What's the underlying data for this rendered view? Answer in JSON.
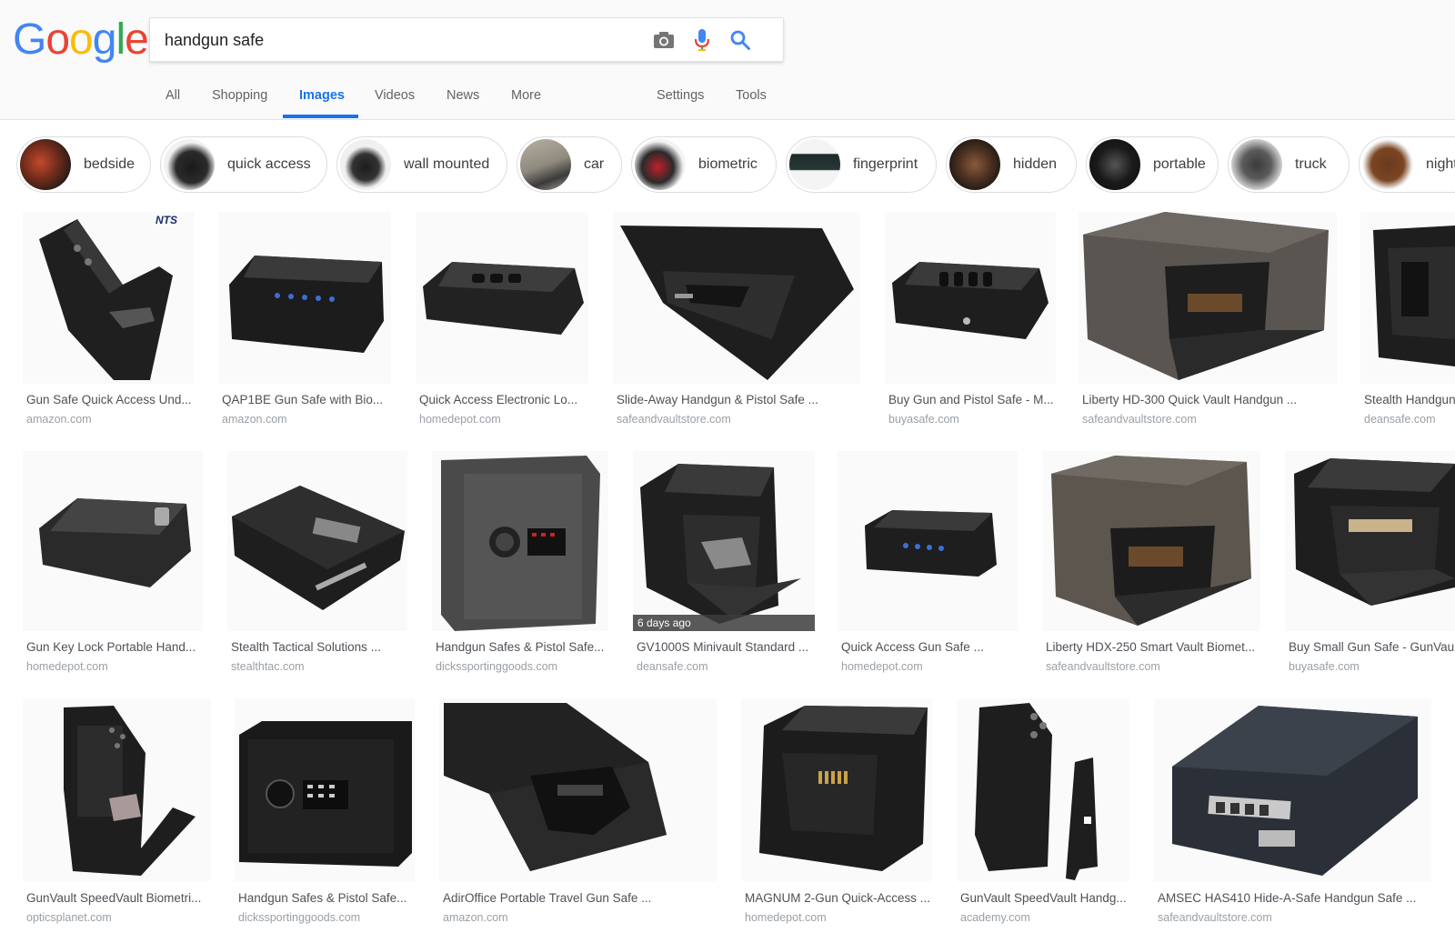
{
  "logo": {
    "letters": [
      "G",
      "o",
      "o",
      "g",
      "l",
      "e"
    ],
    "colors": [
      "#4285f4",
      "#ea4335",
      "#fbbc05",
      "#4285f4",
      "#34a853",
      "#ea4335"
    ]
  },
  "search": {
    "value": "handgun safe",
    "camera_icon": "camera-icon",
    "mic_icon": "mic-icon",
    "search_icon": "search-icon"
  },
  "tabs": [
    {
      "label": "All"
    },
    {
      "label": "Shopping"
    },
    {
      "label": "Images"
    },
    {
      "label": "Videos"
    },
    {
      "label": "News"
    },
    {
      "label": "More"
    },
    {
      "label": "Settings"
    },
    {
      "label": "Tools"
    }
  ],
  "accent_color": "#1a73e8",
  "chips": [
    {
      "label": "bedside"
    },
    {
      "label": "quick access"
    },
    {
      "label": "wall mounted"
    },
    {
      "label": "car"
    },
    {
      "label": "biometric"
    },
    {
      "label": "fingerprint"
    },
    {
      "label": "hidden"
    },
    {
      "label": "portable"
    },
    {
      "label": "truck"
    },
    {
      "label": "nightstand"
    }
  ],
  "results": [
    {
      "title": "Gun Safe Quick Access Und...",
      "domain": "amazon.com",
      "badge": "NTS"
    },
    {
      "title": "QAP1BE Gun Safe with Bio...",
      "domain": "amazon.com"
    },
    {
      "title": "Quick Access Electronic Lo...",
      "domain": "homedepot.com"
    },
    {
      "title": "Slide-Away Handgun & Pistol Safe ...",
      "domain": "safeandvaultstore.com"
    },
    {
      "title": "Buy Gun and Pistol Safe - M...",
      "domain": "buyasafe.com"
    },
    {
      "title": "Liberty HD-300 Quick Vault Handgun ...",
      "domain": "safeandvaultstore.com"
    },
    {
      "title": "Stealth Handgun ...",
      "domain": "deansafe.com"
    },
    {
      "title": "Gun Key Lock Portable Hand...",
      "domain": "homedepot.com"
    },
    {
      "title": "Stealth Tactical Solutions ...",
      "domain": "stealthtac.com"
    },
    {
      "title": "Handgun Safes & Pistol Safe...",
      "domain": "dickssportinggoods.com"
    },
    {
      "title": "GV1000S Minivault Standard ...",
      "domain": "deansafe.com",
      "age": "6 days ago"
    },
    {
      "title": "Quick Access Gun Safe ...",
      "domain": "homedepot.com"
    },
    {
      "title": "Liberty HDX-250 Smart Vault Biomet...",
      "domain": "safeandvaultstore.com"
    },
    {
      "title": "Buy Small Gun Safe - GunVau...",
      "domain": "buyasafe.com"
    },
    {
      "title": "GunVault SpeedVault Biometri...",
      "domain": "opticsplanet.com"
    },
    {
      "title": "Handgun Safes & Pistol Safe...",
      "domain": "dickssportinggoods.com"
    },
    {
      "title": "AdirOffice Portable Travel Gun Safe ...",
      "domain": "amazon.com"
    },
    {
      "title": "MAGNUM 2-Gun Quick-Access ...",
      "domain": "homedepot.com"
    },
    {
      "title": "GunVault SpeedVault Handg...",
      "domain": "academy.com"
    },
    {
      "title": "AMSEC HAS410 Hide-A-Safe Handgun Safe ...",
      "domain": "safeandvaultstore.com"
    }
  ]
}
